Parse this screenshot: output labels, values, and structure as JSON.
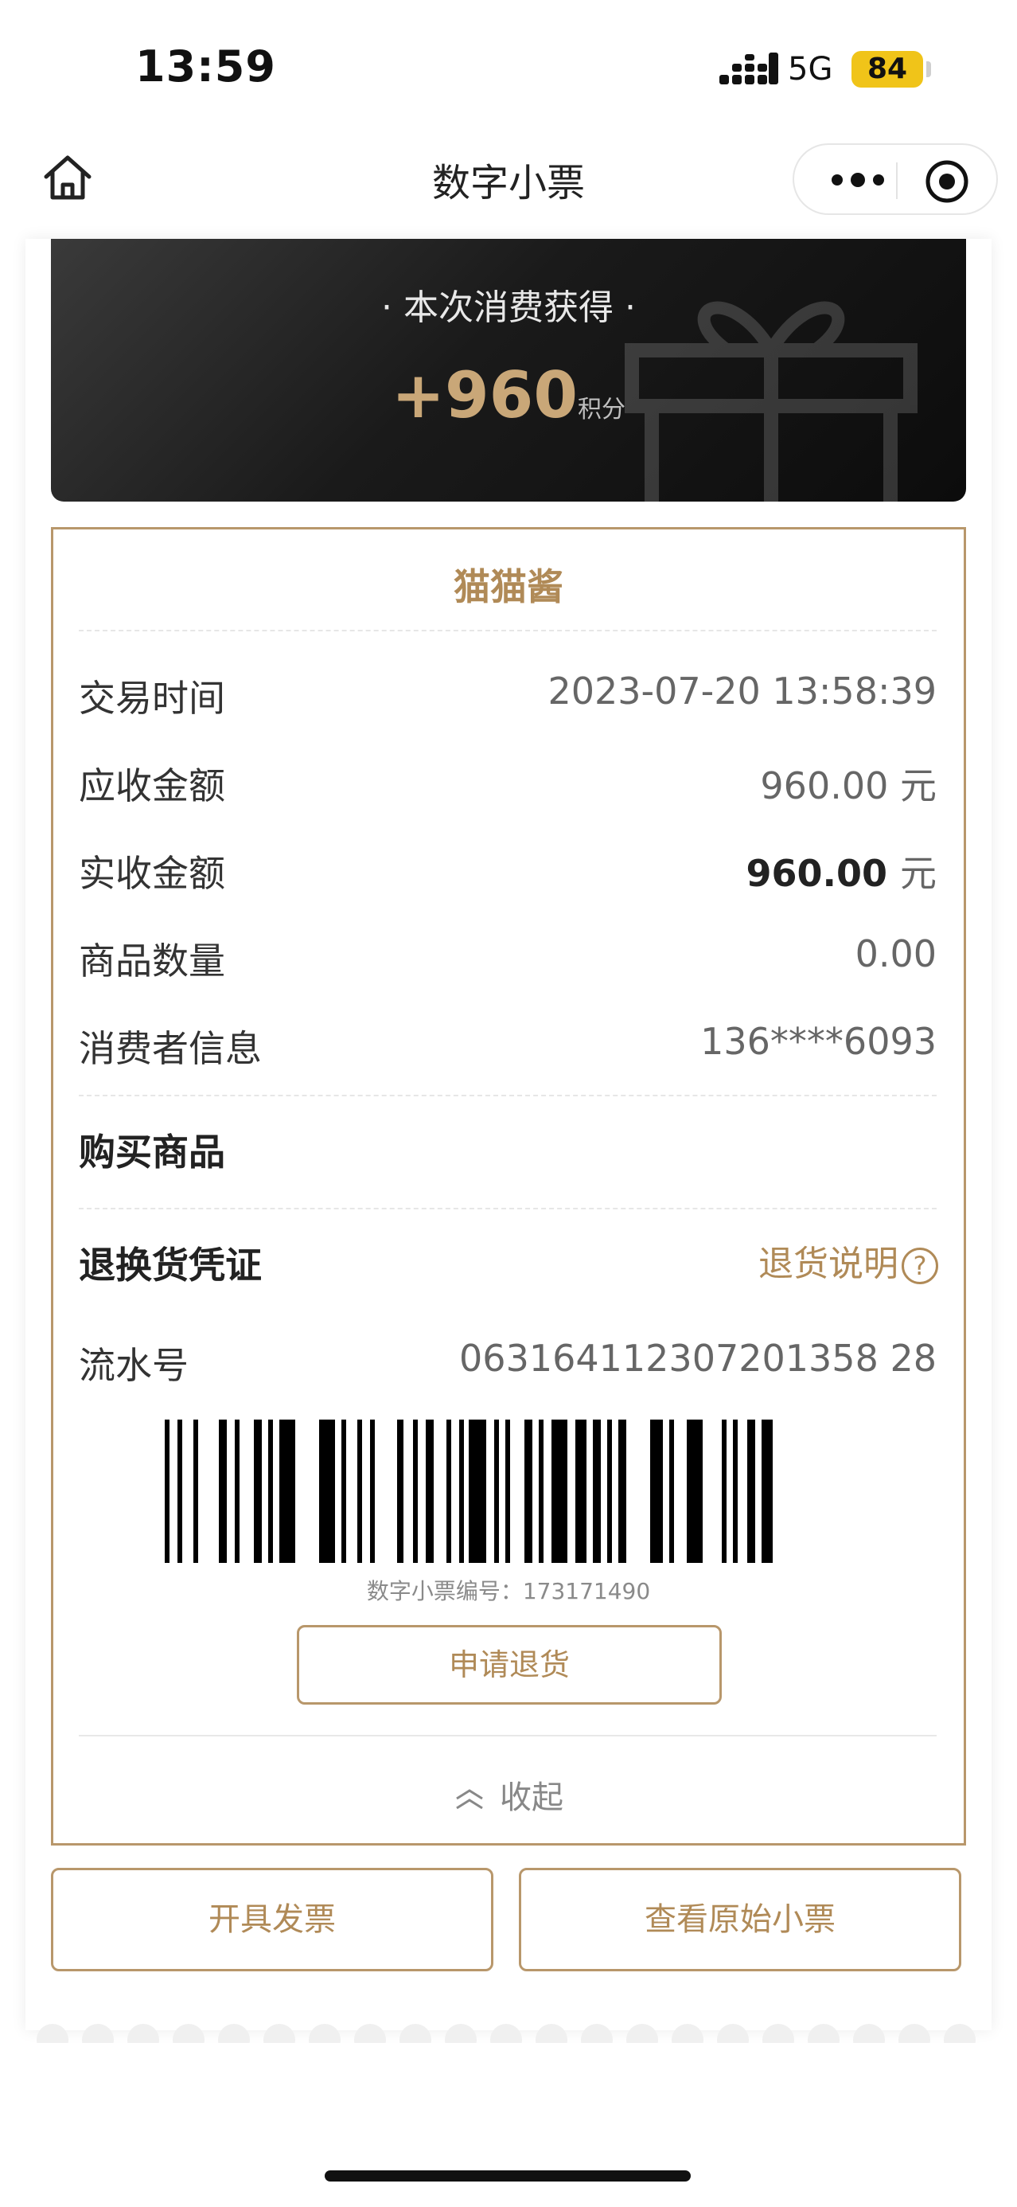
{
  "status_bar": {
    "time": "13:59",
    "network": "5G",
    "battery": "84"
  },
  "nav": {
    "title": "数字小票"
  },
  "banner": {
    "subtitle": "· 本次消费获得 ·",
    "points": "+960",
    "points_unit": "积分"
  },
  "receipt": {
    "store_name": "猫猫酱",
    "rows": [
      {
        "label": "交易时间",
        "value": "2023-07-20 13:58:39",
        "unit": ""
      },
      {
        "label": "应收金额",
        "value": "960.00",
        "unit": "元"
      },
      {
        "label": "实收金额",
        "value": "960.00",
        "unit": "元"
      },
      {
        "label": "商品数量",
        "value": "0.00",
        "unit": ""
      },
      {
        "label": "消费者信息",
        "value": "136****6093",
        "unit": ""
      }
    ],
    "purchased_goods_title": "购买商品",
    "return_voucher_title": "退换货凭证",
    "return_policy_link": "退货说明",
    "serial_label": "流水号",
    "serial_value": "063164112307201358 28",
    "receipt_number": "数字小票编号：173171490",
    "refund_button": "申请退货",
    "collapse_label": "收起"
  },
  "footer": {
    "invoice_button": "开具发票",
    "original_receipt_button": "查看原始小票"
  },
  "colors": {
    "accent": "#b08a57",
    "border": "#b8976b",
    "battery": "#f0c419",
    "banner_dark": "#111111"
  }
}
